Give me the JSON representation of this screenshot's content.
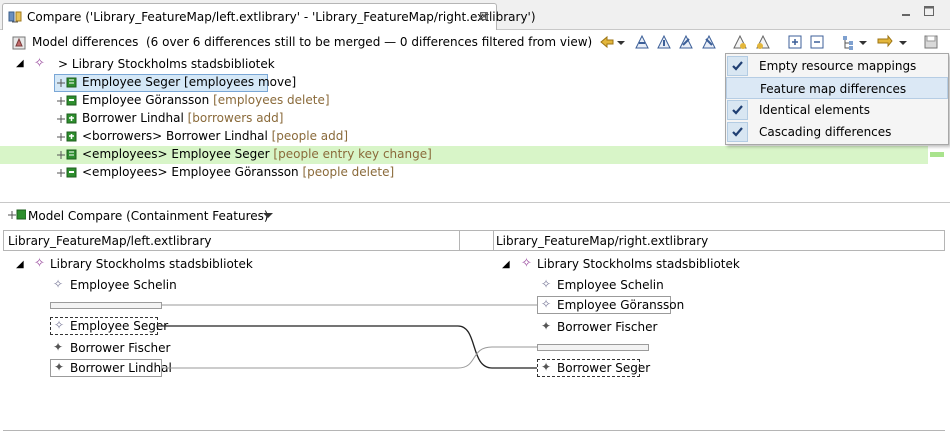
{
  "tab": {
    "title": "Compare ('Library_FeatureMap/left.extlibrary' - 'Library_FeatureMap/right.extlibrary')",
    "close": "⊠"
  },
  "toolbar": {
    "title": "Model differences",
    "summary": "(6 over 6 differences still to be merged — 0 differences filtered from view)"
  },
  "tree": {
    "root": {
      "prefix": ">",
      "label": "Library Stockholms stadsbibliotek"
    },
    "items": [
      {
        "label": "Employee Seger",
        "detail": "[employees move]"
      },
      {
        "label": "Employee Göransson",
        "detail": "[employees delete]"
      },
      {
        "label": "Borrower Lindhal",
        "detail": "[borrowers add]"
      },
      {
        "label": "<borrowers> Borrower Lindhal",
        "detail": "[people add]"
      },
      {
        "label": "<employees> Employee Seger",
        "detail": "[people entry key change]"
      },
      {
        "label": "<employees> Employee Göransson",
        "detail": "[people delete]"
      }
    ]
  },
  "filter_menu": {
    "items": [
      {
        "label": "Empty resource mappings",
        "checked": true
      },
      {
        "label": "Feature map differences",
        "checked": false
      },
      {
        "label": "Identical elements",
        "checked": true
      },
      {
        "label": "Cascading differences",
        "checked": true
      }
    ]
  },
  "compare": {
    "title": "Model Compare (Containment Features)",
    "left_header": "Library_FeatureMap/left.extlibrary",
    "right_header": "Library_FeatureMap/right.extlibrary",
    "left": {
      "root": "Library Stockholms stadsbibliotek",
      "items": [
        "Employee Schelin",
        "Employee Seger",
        "Borrower Fischer",
        "Borrower Lindhal"
      ]
    },
    "right": {
      "root": "Library Stockholms stadsbibliotek",
      "items": [
        "Employee Schelin",
        "Employee Göransson",
        "Borrower Fischer",
        "Borrower Seger"
      ]
    }
  },
  "colors": {
    "accent": "#2a5fa8",
    "highlight_green": "#d8f5c8",
    "selection": "#d5e8f7",
    "detail_text": "#8a6a3a",
    "element_icon": "#9b4da0"
  }
}
